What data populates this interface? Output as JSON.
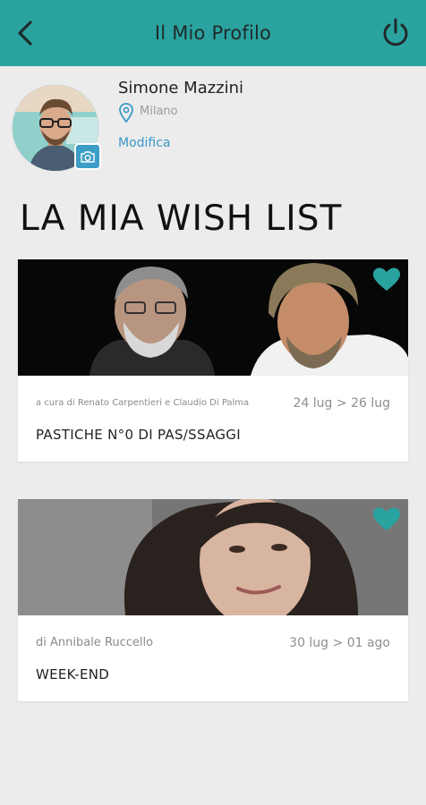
{
  "header": {
    "title": "Il Mio Profilo"
  },
  "profile": {
    "name": "Simone Mazzini",
    "location": "Milano",
    "edit_label": "Modifica"
  },
  "wishlist": {
    "title": "LA MIA WISH LIST",
    "items": [
      {
        "credits": "a cura di Renato Carpentieri e Claudio Di Palma",
        "dates": "24 lug > 26 lug",
        "title": "PASTICHE N°0 DI PAS/SSAGGI"
      },
      {
        "credits": "di Annibale Ruccello",
        "dates": "30 lug > 01 ago",
        "title": "WEEK-END"
      }
    ]
  },
  "colors": {
    "header_bg": "#2aa3a0",
    "accent_link": "#3a98c9",
    "heart": "#2aa3a0",
    "background": "#ececec"
  },
  "icons": [
    "back-arrow-icon",
    "power-icon",
    "location-pin-icon",
    "camera-icon",
    "heart-icon"
  ]
}
